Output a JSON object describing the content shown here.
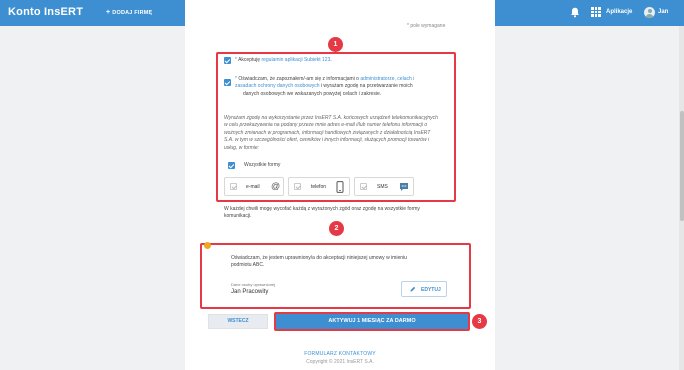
{
  "header": {
    "brand": "Konto InsERT",
    "add_company": "DODAJ FIRMĘ",
    "add_company_plus": "+",
    "apps_label": "Aplikacje",
    "user_name": "Jan"
  },
  "form": {
    "required_note_ast": "*",
    "required_note": "pole wymagane",
    "terms": {
      "ast": "*",
      "prefix": "Akceptuję ",
      "link": "regulamin aplikacji Subiekt 123",
      "suffix": "."
    },
    "privacy": {
      "ast": "*",
      "part1": "Oświadczam, że zapoznałem/-am się z informacjami o ",
      "link1": "administratorze, celach i",
      "link2": "zasadach ochrony danych osobowych",
      "part2": " i wyrażam zgodę na przetwarzanie moich",
      "line3": "danych osobowych we wskazanych powyżej celach i zakresie."
    },
    "marketing_lines": [
      "Wyrażam zgodę na wykorzystanie przez InsERT S.A. końcowych urządzeń telekomunikacyjnych",
      "w celu przekazywania na podany przeze mnie adres e-mail i/lub numer telefonu informacji o",
      "wożnych zmianach w programach, informacji handlowych związanych z działalnością InsERT",
      "S.A. w tym w szczególności ofert, cenników i innych informacji, służących promocji towarów i",
      "usług, w formie:"
    ],
    "all_forms": "Wszystkie formy",
    "channels": {
      "email": "e-mail",
      "email_icon": "@",
      "phone": "telefon",
      "sms": "SMS"
    },
    "withdraw_lines": [
      "W każdej chwili mogę wycofać każdą z wyrażonych zgód oraz zgodę na wszystkie formy",
      "komunikacji."
    ],
    "authority_lines": [
      "Oświadczam, że jestem uprawniony/a do akceptacji niniejszej umowy w imieniu",
      "podmiotu ABC."
    ],
    "authorized_label": "Dane osoby uprawnionej",
    "authorized_name": "Jan Pracowity",
    "edit_label": "EDYTUJ",
    "back_label": "WSTECZ",
    "activate_label": "AKTYWUJ 1 MIESIĄC ZA DARMO"
  },
  "badges": [
    "1",
    "2",
    "3"
  ],
  "footer": {
    "contact": "FORMULARZ KONTAKTOWY",
    "copyright": "Copyright © 2021 InsERT S.A."
  },
  "colors": {
    "primary": "#3d8fd1",
    "highlight": "#e53946",
    "warning": "#f0a821"
  }
}
